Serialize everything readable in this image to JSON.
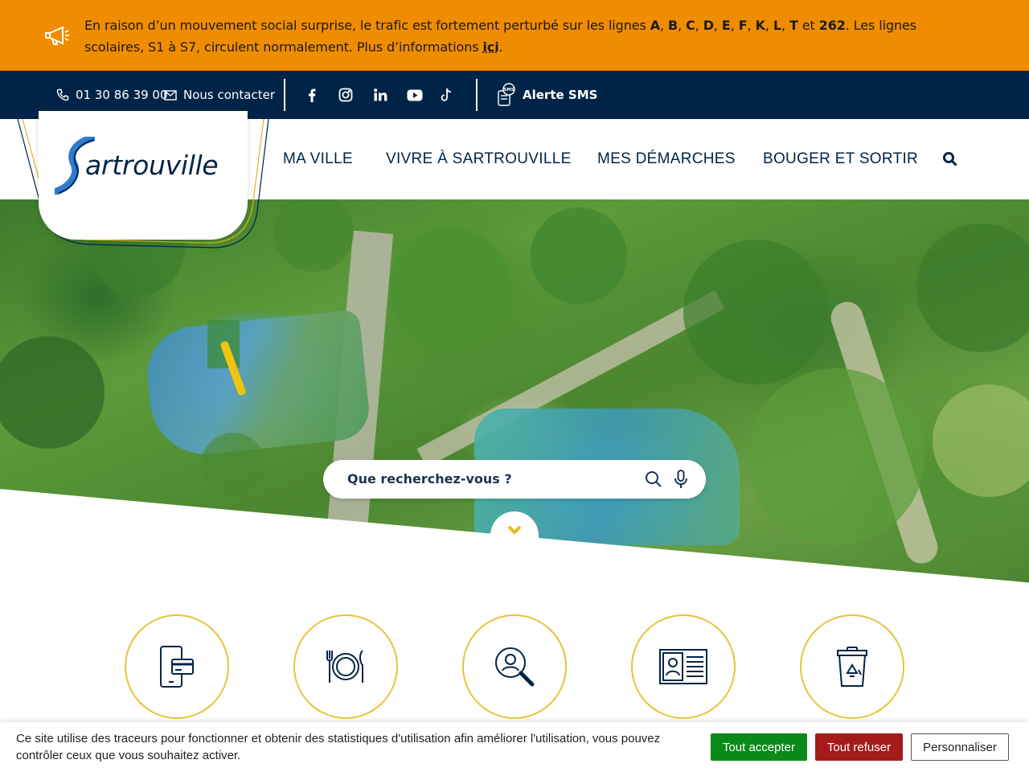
{
  "alert": {
    "seg1": "En raison d’un mouvement social surprise, le trafic est fortement perturbé sur les lignes ",
    "lines": [
      "A",
      "B",
      "C",
      "D",
      "E",
      "F",
      "K",
      "L",
      "T"
    ],
    "sep": ", ",
    "and": " et ",
    "last_line": "262",
    "seg2": ". Les lignes scolaires, S1 à S7, circulent normalement. Plus d’informations ",
    "link": "ici",
    "end": "."
  },
  "topbar": {
    "phone": "01 30 86 39 00",
    "contact": "Nous contacter",
    "social_icons": [
      "facebook-icon",
      "instagram-icon",
      "linkedin-icon",
      "youtube-icon",
      "tiktok-icon"
    ],
    "sms": "Alerte SMS",
    "sms_icon_label": "SMS"
  },
  "logo": {
    "text": "artrouville"
  },
  "nav": {
    "items": [
      "MA VILLE",
      "VIVRE À SARTROUVILLE",
      "MES DÉMARCHES",
      "BOUGER ET SORTIR"
    ]
  },
  "search": {
    "placeholder": "Que recherchez-vous ?"
  },
  "quick_links": [
    "payment-icon",
    "restaurant-icon",
    "search-person-icon",
    "id-card-icon",
    "recycle-bin-icon"
  ],
  "cookie": {
    "message": "Ce site utilise des traceurs pour fonctionner et obtenir des statistiques d'utilisation afin améliorer l'utilisation, vous pouvez contrôler ceux que vous souhaitez activer.",
    "accept": "Tout accepter",
    "refuse": "Tout refuser",
    "customize": "Personnaliser"
  },
  "colors": {
    "alert_bg": "#f08c00",
    "navy": "#002447",
    "accent_yellow": "#e8c33a",
    "logo_blue": "#2e7bcf",
    "accept_green": "#0b8a1a",
    "refuse_red": "#a51a1a"
  }
}
